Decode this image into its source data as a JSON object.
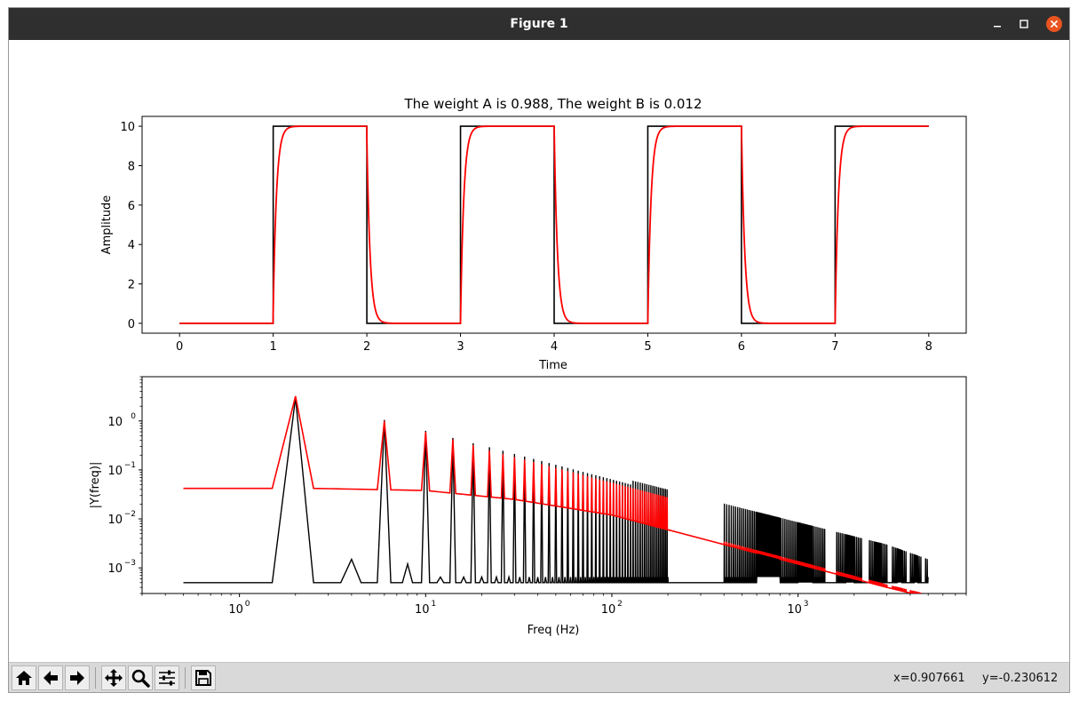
{
  "window": {
    "title": "Figure 1",
    "controls": [
      "minimize-icon",
      "maximize-icon",
      "close-icon"
    ],
    "close_color": "#e95420"
  },
  "toolbar": {
    "buttons": [
      {
        "icon": "home-icon",
        "name": "home-button"
      },
      {
        "icon": "arrow-left-icon",
        "name": "back-button"
      },
      {
        "icon": "arrow-right-icon",
        "name": "forward-button"
      },
      {
        "icon": "pan-icon",
        "name": "pan-button"
      },
      {
        "icon": "zoom-icon",
        "name": "zoom-button"
      },
      {
        "icon": "sliders-icon",
        "name": "configure-subplots-button"
      },
      {
        "icon": "save-icon",
        "name": "save-button"
      }
    ],
    "coord_x": "x=0.907661",
    "coord_y": "y=-0.230612"
  },
  "chart_data": [
    {
      "type": "line",
      "title": "The weight A is 0.988, The weight B is 0.012",
      "xlabel": "Time",
      "ylabel": "Amplitude",
      "xlim": [
        -0.4,
        8.4
      ],
      "ylim": [
        -0.5,
        10.5
      ],
      "xticks": [
        "0",
        "1",
        "2",
        "3",
        "4",
        "5",
        "6",
        "7",
        "8"
      ],
      "yticks": [
        "0",
        "2",
        "4",
        "6",
        "8",
        "10"
      ],
      "series": [
        {
          "color": "#000000",
          "kind": "square-wave",
          "low": 0,
          "high": 10,
          "edges": [
            1,
            2,
            3,
            4,
            5,
            6,
            7,
            8
          ],
          "x_start": 0,
          "x_end": 8
        },
        {
          "color": "#ff0000",
          "kind": "first-order-response",
          "low": 0,
          "high": 10,
          "time_constant": 0.035,
          "edges": [
            1,
            2,
            3,
            4,
            5,
            6,
            7,
            8
          ],
          "x_start": 0,
          "x_end": 8
        }
      ]
    },
    {
      "type": "line",
      "xlabel": "Freq (Hz)",
      "ylabel": "|Y(freq)|",
      "xscale": "log",
      "yscale": "log",
      "xlim": [
        0.3,
        8000
      ],
      "ylim": [
        0.0003,
        8
      ],
      "xticks": [
        "10^0",
        "10^1",
        "10^2",
        "10^3"
      ],
      "yticks": [
        "10^-3",
        "10^-2",
        "10^-1",
        "10^0"
      ],
      "series": [
        {
          "color": "#000000",
          "kind": "square-wave-spectrum",
          "baseline": 0.0005,
          "peaks": [
            {
              "f": 2,
              "v": 3.0
            },
            {
              "f": 4,
              "v": 0.0015
            },
            {
              "f": 6,
              "v": 1.05
            },
            {
              "f": 8,
              "v": 0.0012
            },
            {
              "f": 10,
              "v": 0.63
            },
            {
              "f": 14,
              "v": 0.45
            },
            {
              "f": 18,
              "v": 0.35
            },
            {
              "f": 22,
              "v": 0.29
            }
          ],
          "f_max": 5000,
          "dense_upper": [
            {
              "f": 130,
              "v": 0.06
            },
            {
              "f": 3000,
              "v": 0.003
            },
            {
              "f": 5000,
              "v": 0.0015
            }
          ],
          "dense_lower": 0.0005
        },
        {
          "color": "#ff0000",
          "kind": "filtered-spectrum",
          "floor": [
            {
              "f": 0.5,
              "v": 0.042
            },
            {
              "f": 1.5,
              "v": 0.042
            },
            {
              "f": 2.5,
              "v": 0.042
            },
            {
              "f": 10,
              "v": 0.038
            },
            {
              "f": 30,
              "v": 0.025
            },
            {
              "f": 100,
              "v": 0.012
            },
            {
              "f": 1000,
              "v": 0.0012
            },
            {
              "f": 3000,
              "v": 0.0004
            },
            {
              "f": 5000,
              "v": 0.00025
            }
          ],
          "peaks": [
            {
              "f": 2,
              "v": 3.2
            },
            {
              "f": 6,
              "v": 1.0
            },
            {
              "f": 10,
              "v": 0.6
            },
            {
              "f": 14,
              "v": 0.42
            },
            {
              "f": 18,
              "v": 0.32
            },
            {
              "f": 22,
              "v": 0.25
            }
          ]
        }
      ]
    }
  ]
}
